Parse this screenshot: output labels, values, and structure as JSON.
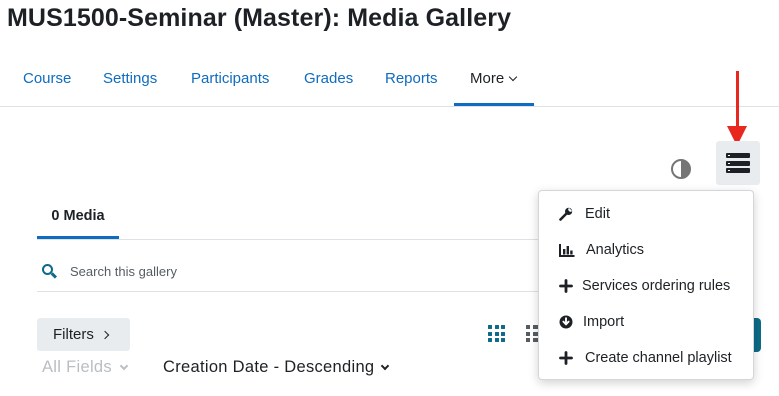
{
  "page": {
    "title": "MUS1500-Seminar (Master): Media Gallery"
  },
  "nav": {
    "items": [
      {
        "label": "Course"
      },
      {
        "label": "Settings"
      },
      {
        "label": "Participants"
      },
      {
        "label": "Grades"
      },
      {
        "label": "Reports"
      },
      {
        "label": "More"
      }
    ],
    "active": "More"
  },
  "gallery": {
    "media_tab_label": "0 Media",
    "search_placeholder": "Search this gallery",
    "filters_label": "Filters",
    "field_filter": "All Fields",
    "sort_selected": "Creation Date - Descending"
  },
  "actions_menu": {
    "items": [
      {
        "label": "Edit",
        "icon": "wrench-icon"
      },
      {
        "label": "Analytics",
        "icon": "bar-chart-icon"
      },
      {
        "label": "Services ordering rules",
        "icon": "plus-icon"
      },
      {
        "label": "Import",
        "icon": "download-circle-icon"
      },
      {
        "label": "Create channel playlist",
        "icon": "plus-icon"
      }
    ]
  },
  "colors": {
    "link_blue": "#0f6cbf",
    "accent_teal": "#0e6b87",
    "annotation_red": "#e8281e",
    "button_grey": "#e9ecef"
  }
}
